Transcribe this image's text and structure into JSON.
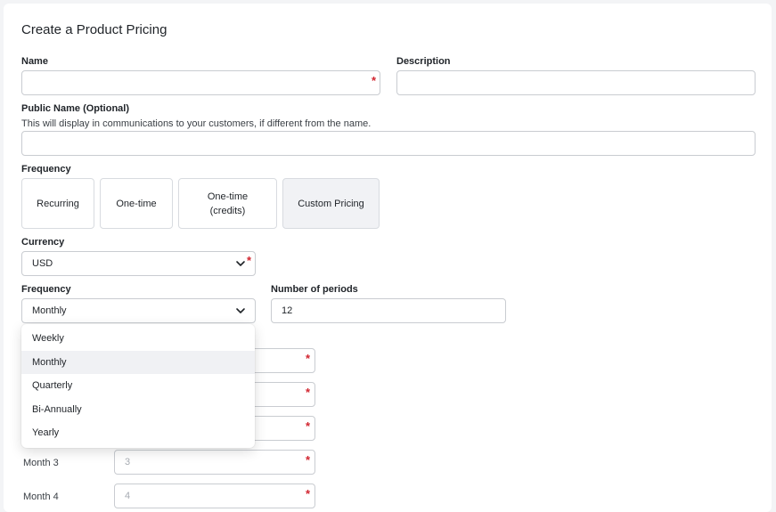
{
  "page": {
    "title": "Create a Product Pricing"
  },
  "form": {
    "name_label": "Name",
    "description_label": "Description",
    "public_name_label": "Public Name (Optional)",
    "public_name_help": "This will display in communications to your customers, if different from the name.",
    "frequency_type_label": "Frequency",
    "frequency_options": [
      {
        "label": "Recurring",
        "selected": false
      },
      {
        "label": "One-time",
        "selected": false
      },
      {
        "label": "One-time\n(credits)",
        "selected": false
      },
      {
        "label": "Custom Pricing",
        "selected": true
      }
    ],
    "currency_label": "Currency",
    "currency_value": "USD",
    "frequency_label": "Frequency",
    "frequency_value": "Monthly",
    "periods_label": "Number of periods",
    "periods_value": "12"
  },
  "dropdown": {
    "items": [
      {
        "label": "Weekly",
        "selected": false
      },
      {
        "label": "Monthly",
        "selected": true
      },
      {
        "label": "Quarterly",
        "selected": false
      },
      {
        "label": "Bi-Annually",
        "selected": false
      },
      {
        "label": "Yearly",
        "selected": false
      }
    ]
  },
  "months": [
    {
      "label": "Month 3",
      "placeholder": "3"
    },
    {
      "label": "Month 4",
      "placeholder": "4"
    }
  ],
  "colors": {
    "required": "#d1242f",
    "selected_bg": "#f1f2f5"
  }
}
